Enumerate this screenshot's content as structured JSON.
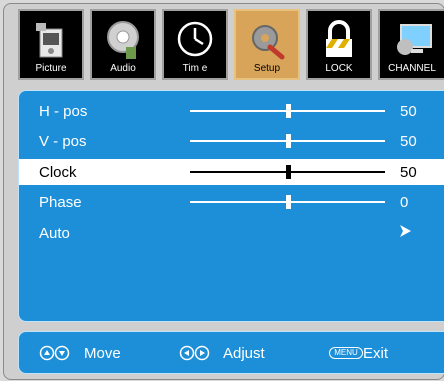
{
  "tabs": [
    {
      "label": "Picture",
      "icon": "picture-icon",
      "active": false
    },
    {
      "label": "Audio",
      "icon": "audio-icon",
      "active": false
    },
    {
      "label": "Tim e",
      "icon": "clock-icon",
      "active": false
    },
    {
      "label": "Setup",
      "icon": "setup-icon",
      "active": true
    },
    {
      "label": "LOCK",
      "icon": "lock-icon",
      "active": false
    },
    {
      "label": "CHANNEL",
      "icon": "channel-icon",
      "active": false
    }
  ],
  "menu": {
    "items": [
      {
        "label": "H - pos",
        "value": "50",
        "level": 50,
        "type": "slider",
        "selected": false
      },
      {
        "label": "V - pos",
        "value": "50",
        "level": 50,
        "type": "slider",
        "selected": false
      },
      {
        "label": "Clock",
        "value": "50",
        "level": 50,
        "type": "slider",
        "selected": true
      },
      {
        "label": "Phase",
        "value": "0",
        "level": 50,
        "type": "slider",
        "selected": false
      },
      {
        "label": "Auto",
        "type": "action",
        "icon": "arrow-right-icon",
        "selected": false
      }
    ]
  },
  "help": {
    "move_label": "Move",
    "adjust_label": "Adjust",
    "menu_key": "MENU",
    "exit_label": "Exit"
  },
  "colors": {
    "panel": "#1d8fd8",
    "active_tab": "#d7a45a",
    "selected_row": "#ffffff"
  }
}
